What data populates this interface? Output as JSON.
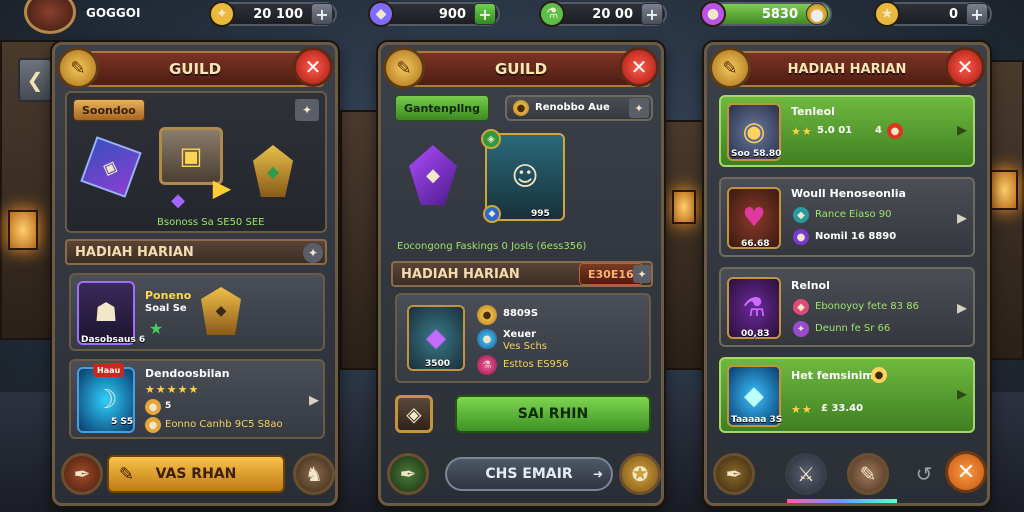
{
  "player": {
    "name": "GOGGOI"
  },
  "resources": [
    {
      "name": "energy",
      "icon": "✦",
      "value": "20 100",
      "color": "#e8b93c"
    },
    {
      "name": "gems",
      "icon": "◆",
      "value": "900",
      "color": "#7c6cff"
    },
    {
      "name": "potions",
      "icon": "⚗",
      "value": "20 00",
      "color": "#5ac04a"
    },
    {
      "name": "coins",
      "icon": "●",
      "value": "5830",
      "color": "#b855e6"
    },
    {
      "name": "stars",
      "icon": "★",
      "value": "0",
      "color": "#e8b93c"
    }
  ],
  "left_panel": {
    "title": "GUILD",
    "tag": "Soondoo",
    "reward_caption": "Bsonoss Sa SE50 SEE",
    "section_title": "HADIAH HARIAN",
    "item1": {
      "name": "Poneno",
      "sub": "Soal Se",
      "badge": "Dasobsaus 6"
    },
    "item2": {
      "name": "Dendoosbilan",
      "badge": "Haau",
      "count": "5 S5",
      "stars": "★★★★★",
      "sub": "Eonno Canhb 9C5 S8ao",
      "count2": "5"
    },
    "button": "VAS RHAN"
  },
  "middle_panel": {
    "title": "GUILD",
    "tag": "Gantenpllng",
    "coin_label": "Renobbo Aue",
    "hero_level": "995",
    "caption": "Eocongong Faskings 0 Josls (6ess356)",
    "section_title": "HADIAH HARIAN",
    "section_value": "E30E16",
    "reward_count": "3500",
    "rows": [
      {
        "text": "8809S",
        "color": "#f3d35a"
      },
      {
        "text": "Xeuer",
        "sub": "Ves Schs",
        "color": "#f3d35a"
      },
      {
        "text": "Esttos ES956",
        "color": "#f3d35a"
      }
    ],
    "green_button": "SAI RHIN",
    "slate_button": "CHS EMAIR"
  },
  "right_panel": {
    "title": "HADIAH HARIAN",
    "rows": [
      {
        "title": "Tenleol",
        "stars": "★★",
        "sub": "5.0 01",
        "count": "4",
        "badge": "Soo 58.80",
        "style": "green"
      },
      {
        "title": "Woull Henoseonlia",
        "sub1": "Rance Eiaso 90",
        "sub2": "Nomil 16 8890",
        "badge": "66.68",
        "style": "gray"
      },
      {
        "title": "Relnol",
        "sub1": "Ebonoyoy fete 83 86",
        "sub2": "Deunn fe Sr 66",
        "badge": "00,83",
        "style": "gray"
      },
      {
        "title": "Het femsinim",
        "stars": "★★",
        "sub": "£ 33.40",
        "badge": "Taaaaa 3S",
        "style": "green"
      }
    ]
  }
}
